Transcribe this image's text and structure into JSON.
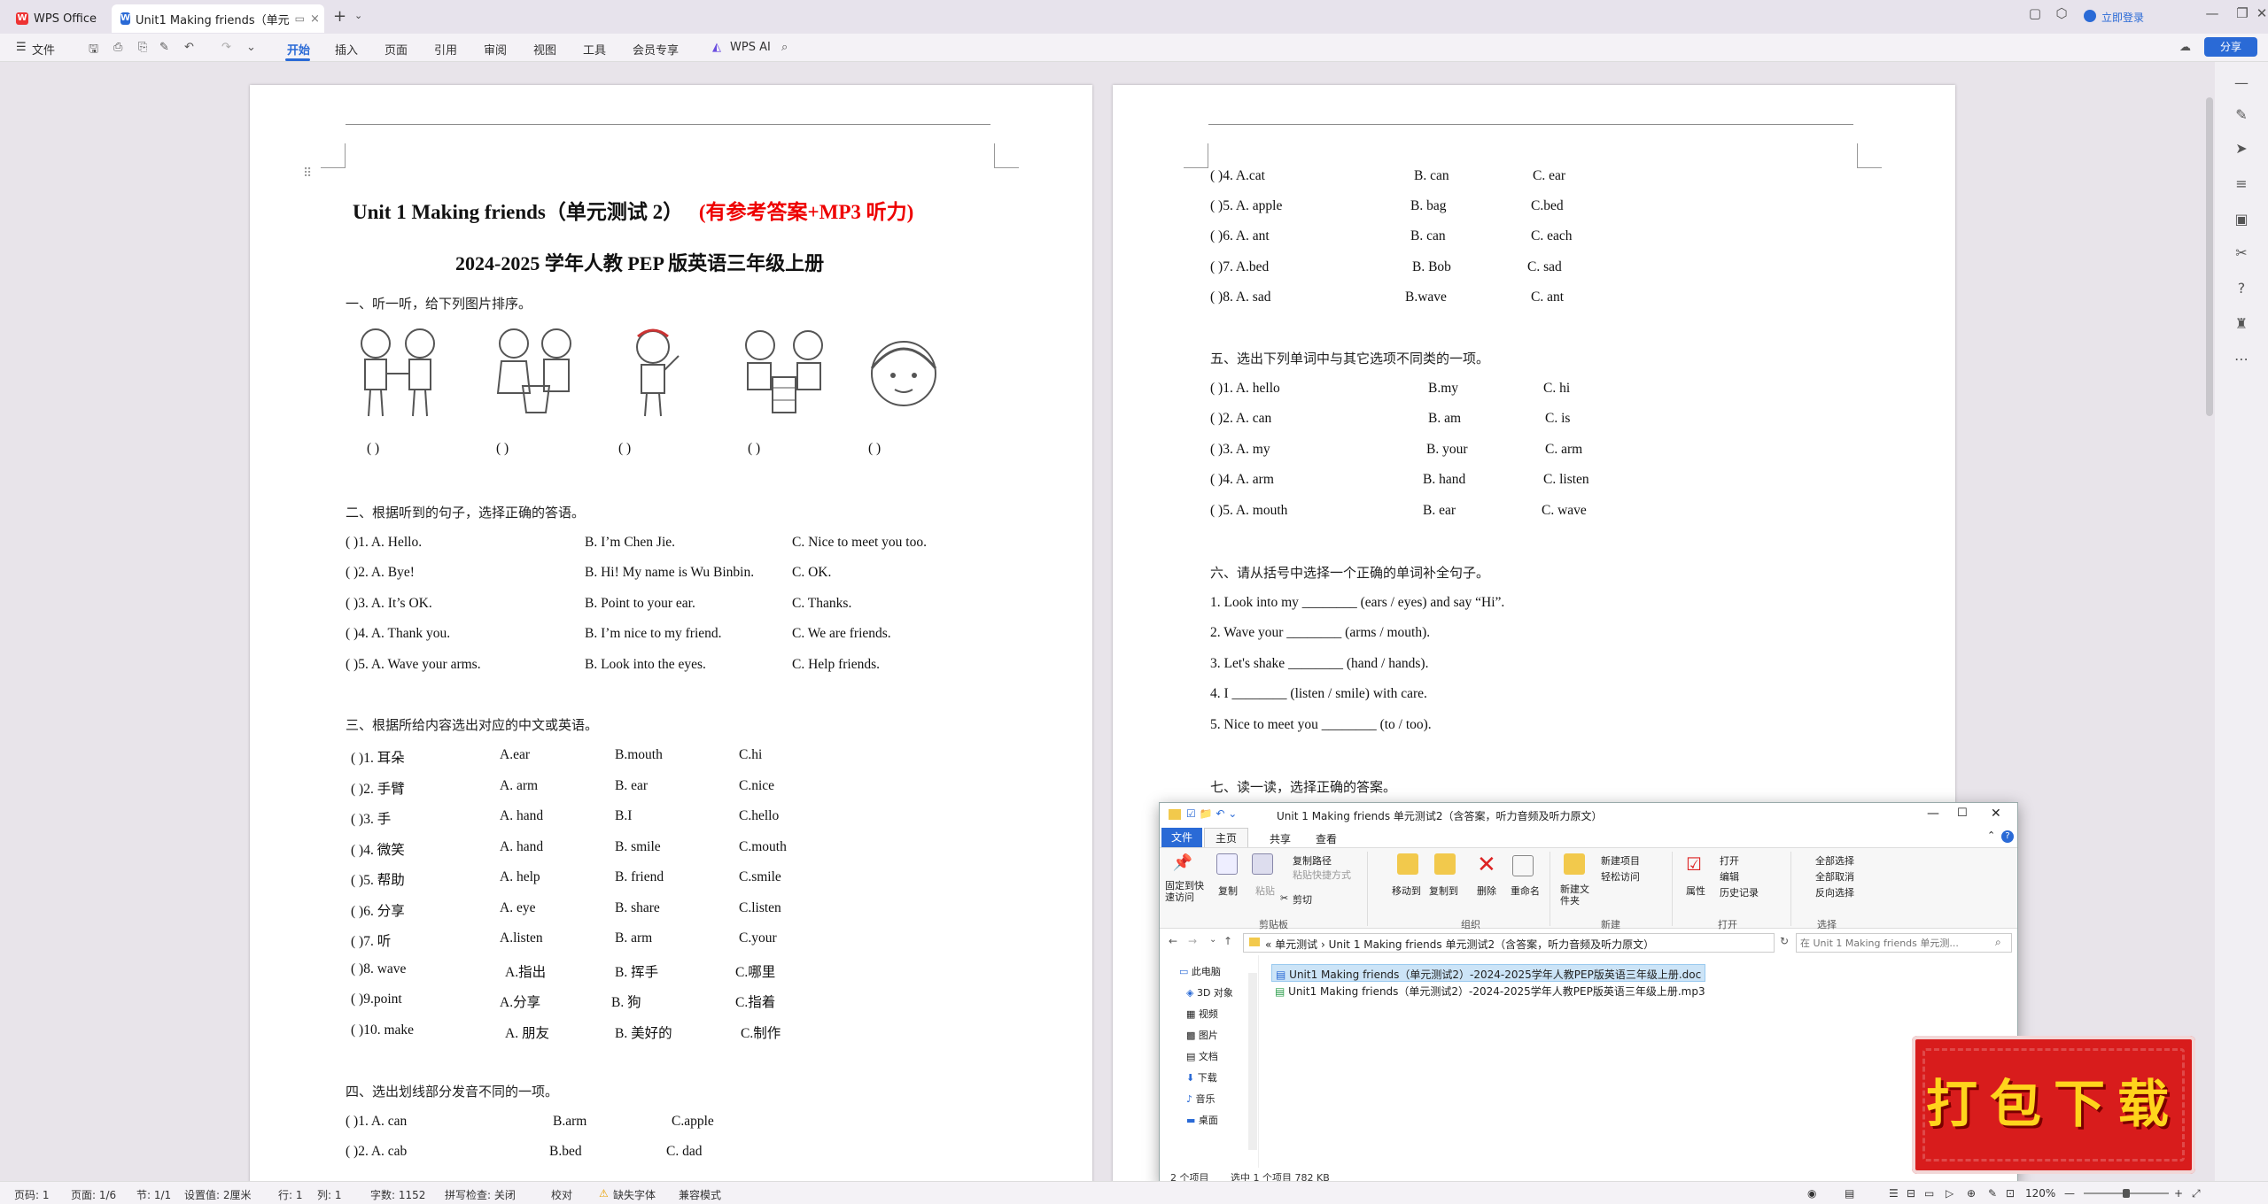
{
  "app": {
    "home_tab": "WPS Office",
    "doc_tab": "Unit1 Making friends（单元",
    "login": "立即登录",
    "share": "分享"
  },
  "ribbon": {
    "file": "文件",
    "tabs": [
      "开始",
      "插入",
      "页面",
      "引用",
      "审阅",
      "视图",
      "工具",
      "会员专享"
    ],
    "wps_ai": "WPS AI"
  },
  "page1": {
    "title_black": "Unit    1 Making friends（单元测试 2）",
    "title_red": "(有参考答案+MP3 听力)",
    "subtitle": "2024-2025 学年人教 PEP 版英语三年级上册",
    "sec1": "一、听一听，给下列图片排序。",
    "paren": "(          )",
    "sec2": "二、根据听到的句子，选择正确的答语。",
    "q2": [
      {
        "n": "(          )1. A. Hello.",
        "b": "B. I’m Chen Jie.",
        "c": "C. Nice to meet you too."
      },
      {
        "n": "(          )2. A. Bye!",
        "b": "B. Hi! My name is Wu Binbin.",
        "c": "C. OK."
      },
      {
        "n": "(          )3. A. It’s OK.",
        "b": "B. Point to your ear.",
        "c": "C. Thanks."
      },
      {
        "n": "(          )4. A. Thank you.",
        "b": "B. I’m nice to my friend.",
        "c": "C. We are friends."
      },
      {
        "n": "(          )5. A. Wave your arms.",
        "b": "B. Look into the eyes.",
        "c": "C. Help friends."
      }
    ],
    "sec3": "三、根据所给内容选出对应的中文或英语。",
    "q3": [
      {
        "n": "(               )1.  耳朵",
        "a": "A.ear",
        "b": "B.mouth",
        "c": "C.hi"
      },
      {
        "n": "(               )2.  手臂",
        "a": "A. arm",
        "b": "B. ear",
        "c": "C.nice"
      },
      {
        "n": "(               )3.  手",
        "a": "A. hand",
        "b": "B.I",
        "c": "C.hello"
      },
      {
        "n": "(               )4.  微笑",
        "a": "A. hand",
        "b": "B. smile",
        "c": "C.mouth"
      },
      {
        "n": "(               )5.  帮助",
        "a": "A. help",
        "b": "B. friend",
        "c": "C.smile"
      },
      {
        "n": "(               )6.  分享",
        "a": "A. eye",
        "b": "B. share",
        "c": "C.listen"
      },
      {
        "n": "(               )7.  听",
        "a": "A.listen",
        "b": "B. arm",
        "c": "C.your"
      },
      {
        "n": "(               )8. wave",
        "a": "A.指出",
        "b": "B. 挥手",
        "c": "C.哪里"
      },
      {
        "n": "(               )9.point",
        "a": "A.分享",
        "b": "B. 狗",
        "c": "C.指着"
      },
      {
        "n": "(               )10. make",
        "a": "A. 朋友",
        "b": "B. 美好的",
        "c": "C.制作"
      }
    ],
    "sec4": "四、选出划线部分发音不同的一项。",
    "q4": [
      {
        "n": "(               )1. A.    can",
        "b": "B.arm",
        "c": "C.apple"
      },
      {
        "n": "(               )2. A. cab",
        "b": "B.bed",
        "c": "C.    dad"
      }
    ]
  },
  "page2": {
    "q4b": [
      {
        "n": "(               )4. A.cat",
        "b": "B. can",
        "c": "C. ear"
      },
      {
        "n": "(               )5. A. apple",
        "b": "B. bag",
        "c": "C.bed"
      },
      {
        "n": "(               )6. A. ant",
        "b": "B. can",
        "c": "C. each"
      },
      {
        "n": "(               )7. A.bed",
        "b": "B. Bob",
        "c": "C. sad"
      },
      {
        "n": "(               )8. A. sad",
        "b": "B.wave",
        "c": "C. ant"
      }
    ],
    "sec5": "五、选出下列单词中与其它选项不同类的一项。",
    "q5": [
      {
        "n": "(               )1. A. hello",
        "b": "B.my",
        "c": "C. hi"
      },
      {
        "n": "(               )2. A. can",
        "b": "B. am",
        "c": "C. is"
      },
      {
        "n": "(               )3. A. my",
        "b": "B. your",
        "c": "C. arm"
      },
      {
        "n": "(               )4. A. arm",
        "b": "B. hand",
        "c": "C. listen"
      },
      {
        "n": "(               )5. A. mouth",
        "b": "B. ear",
        "c": "C.     wave"
      }
    ],
    "sec6": "六、请从括号中选择一个正确的单词补全句子。",
    "q6": [
      "1. Look into my ________ (ears / eyes) and say “Hi”.",
      "2. Wave your ________ (arms / mouth).",
      "3. Let's shake ________ (hand / hands).",
      "4. I ________ (listen / smile) with care.",
      "5. Nice to meet you ________ (to / too)."
    ],
    "sec7": "七、读一读，选择正确的答案。"
  },
  "explorer": {
    "title": "Unit 1 Making friends 单元测试2（含答案，听力音频及听力原文）",
    "tabs": [
      "文件",
      "主页",
      "共享",
      "查看"
    ],
    "clipboard": {
      "pin": "固定到快速访问",
      "copy": "复制",
      "paste": "粘贴",
      "copy_path": "复制路径",
      "paste_shortcut": "粘贴快捷方式",
      "cut": "剪切",
      "group": "剪贴板"
    },
    "organize": {
      "move": "移动到",
      "copyto": "复制到",
      "delete": "删除",
      "rename": "重命名",
      "group": "组织"
    },
    "new": {
      "folder": "新建文件夹",
      "item": "新建项目",
      "easy": "轻松访问",
      "group": "新建"
    },
    "open": {
      "props": "属性",
      "open": "打开",
      "edit": "编辑",
      "history": "历史记录",
      "group": "打开"
    },
    "select": {
      "all": "全部选择",
      "none": "全部取消",
      "invert": "反向选择",
      "group": "选择"
    },
    "path": "«  单元测试  ›  Unit 1 Making friends 单元测试2（含答案，听力音频及听力原文）",
    "search_placeholder": "在 Unit 1 Making friends 单元测...",
    "nav": [
      "此电脑",
      "3D 对象",
      "视频",
      "图片",
      "文档",
      "下载",
      "音乐",
      "桌面"
    ],
    "files": [
      "Unit1 Making friends（单元测试2）-2024-2025学年人教PEP版英语三年级上册.doc",
      "Unit1 Making friends（单元测试2）-2024-2025学年人教PEP版英语三年级上册.mp3"
    ],
    "status_count": "2 个项目",
    "status_sel": "选中 1 个项目  782 KB"
  },
  "badge": "打包下载",
  "status": {
    "page": "页码: 1",
    "pages": "页面: 1/6",
    "section": "节: 1/1",
    "setting": "设置值: 2厘米",
    "row": "行: 1",
    "col": "列: 1",
    "words": "字数: 1152",
    "spell": "拼写检查: 关闭",
    "proof": "校对",
    "missing_font": "缺失字体",
    "compat": "兼容模式",
    "zoom": "120%"
  }
}
